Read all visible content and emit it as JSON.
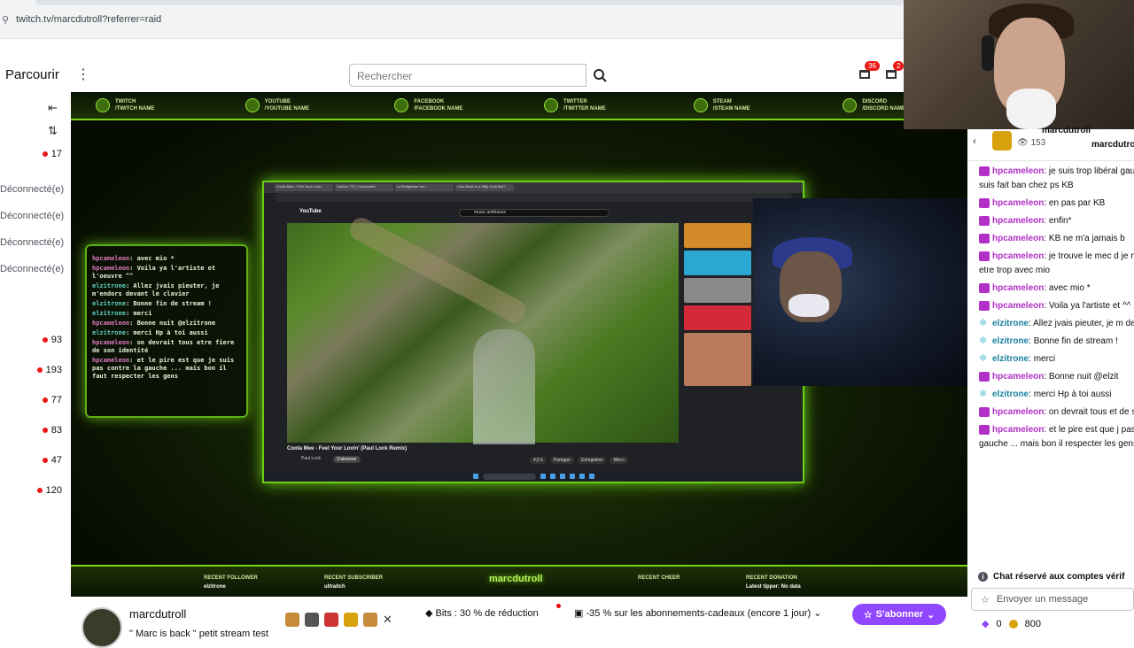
{
  "browser": {
    "url": "twitch.tv/marcdutroll?referrer=raid"
  },
  "topnav": {
    "brand": "Parcourir",
    "search_placeholder": "Rechercher",
    "badge_left": "36",
    "badge_right": "2"
  },
  "rail": {
    "top_count": "17",
    "offline": [
      "Déconnecté(e)",
      "Déconnecté(e)",
      "Déconnecté(e)",
      "Déconnecté(e)"
    ],
    "counts": [
      "93",
      "193",
      "77",
      "83",
      "47",
      "120"
    ]
  },
  "overlay": {
    "socials": [
      {
        "title": "TWITCH",
        "handle": "/TWITCH NAME"
      },
      {
        "title": "YOUTUBE",
        "handle": "/YOUTUBE NAME"
      },
      {
        "title": "FACEBOOK",
        "handle": "/FACEBOOK NAME"
      },
      {
        "title": "TWITTER",
        "handle": "/TWITTER NAME"
      },
      {
        "title": "STEAM",
        "handle": "/STEAM NAME"
      },
      {
        "title": "DISCORD",
        "handle": "/DISCORD NAME"
      }
    ],
    "chat": [
      {
        "user": "hpcameleon",
        "text": "avec mio *",
        "color": "pink"
      },
      {
        "user": "hpcameleon",
        "text": "Voila ya l'artiste et l'oeuvre ^^",
        "color": "pink"
      },
      {
        "user": "elzitrone",
        "text": "Allez jvais pieuter, je m'endors devant le clavier",
        "color": "cyan"
      },
      {
        "user": "elzitrone",
        "text": "Bonne fin de stream !",
        "color": "cyan"
      },
      {
        "user": "elzitrone",
        "text": "merci",
        "color": "cyan"
      },
      {
        "user": "hpcameleon",
        "text": "Bonne nuit @elzitrone",
        "color": "pink"
      },
      {
        "user": "elzitrone",
        "text": "merci Hp à toi aussi",
        "color": "cyan"
      },
      {
        "user": "hpcameleon",
        "text": "on devrait tous etre fiere de son identité",
        "color": "pink"
      },
      {
        "user": "hpcameleon",
        "text": "et le pire est que je suis pas contre la gauche ... mais bon il faut respecter les gens",
        "color": "pink"
      }
    ],
    "bottom": {
      "follower_label": "RECENT FOLLOWER",
      "follower": "elzitrone",
      "subscriber_label": "RECENT SUBSCRIBER",
      "subscriber": "ultraitch",
      "name": "marcdutroll",
      "cheer_label": "RECENT CHEER",
      "cheer": "",
      "donation_label": "RECENT DONATION",
      "donation": "Latest tipper: No data"
    }
  },
  "screen": {
    "tabs": [
      "Coota Mee - Feel Your Lovin",
      "Carbon 737 | Conducted",
      "La Religieuse aux ...",
      "How Much is a 9Big Gold Bar?"
    ],
    "yt_logo": "YouTube",
    "yt_search": "music ambiance",
    "video_title": "Coota Mee - Feel Your Lovin' (Paul Lock Remix)",
    "channel": "Paul Lock",
    "subscribe": "S'abonner",
    "actions": [
      "4,5 k",
      "Partager",
      "Enregistrer",
      "Merci"
    ]
  },
  "below": {
    "channel": "marcdutroll",
    "title": "\" Marc is back \" petit stream test",
    "bits": "Bits : 30 % de réduction",
    "gift": "-35 % sur les abonnements-cadeaux (encore 1 jour)",
    "subscribe": "S'abonner"
  },
  "chat_header": {
    "name": "marcdutroll",
    "name2": "marcdutroll",
    "count": "153"
  },
  "chat": [
    {
      "user": "hpcameleon",
      "text": "je suis trop libéral gauche, je me suis fait ban chez ps KB",
      "type": "pink"
    },
    {
      "user": "hpcameleon",
      "text": "en pas par KB",
      "type": "pink"
    },
    {
      "user": "hpcameleon",
      "text": "enfin*",
      "type": "pink"
    },
    {
      "user": "hpcameleon",
      "text": "KB ne m'a jamais b",
      "type": "pink"
    },
    {
      "user": "hpcameleon",
      "text": "je trouve le mec d je me lache peut etre trop avec mio",
      "type": "pink"
    },
    {
      "user": "hpcameleon",
      "text": "avec mio *",
      "type": "pink"
    },
    {
      "user": "hpcameleon",
      "text": "Voila ya l'artiste et ^^",
      "type": "pink"
    },
    {
      "user": "elzitrone",
      "text": "Allez jvais pieuter, je m devant le clavier",
      "type": "cyan"
    },
    {
      "user": "elzitrone",
      "text": "Bonne fin de stream !",
      "type": "cyan"
    },
    {
      "user": "elzitrone",
      "text": "merci",
      "type": "cyan"
    },
    {
      "user": "hpcameleon",
      "text": "Bonne nuit @elzit",
      "type": "pink"
    },
    {
      "user": "elzitrone",
      "text": "merci Hp à toi aussi",
      "type": "cyan"
    },
    {
      "user": "hpcameleon",
      "text": "on devrait tous et de son identité 🙈",
      "type": "pink"
    },
    {
      "user": "hpcameleon",
      "text": "et le pire est que j pas contre la gauche ... mais bon il respecter les gens 🙈",
      "type": "pink"
    }
  ],
  "chat_footer": {
    "notice": "Chat réservé aux comptes vérif",
    "placeholder": "Envoyer un message",
    "bits": "0",
    "points": "800"
  },
  "colors": {
    "accent": "#9147ff",
    "live": "#e91916",
    "overlay_green": "#7ad31a"
  }
}
